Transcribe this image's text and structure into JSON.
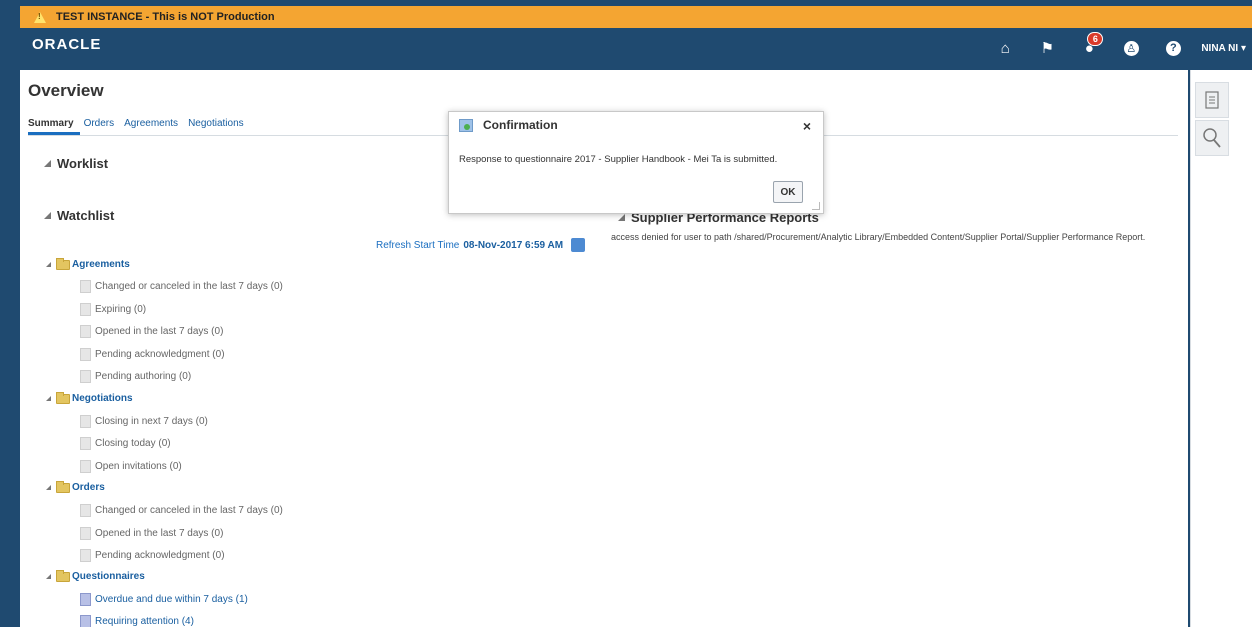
{
  "banner": {
    "text": "TEST INSTANCE - This is NOT Production"
  },
  "header": {
    "logo": "ORACLE",
    "notification_count": "6",
    "user": "NINA NI"
  },
  "page": {
    "title": "Overview",
    "tabs": [
      "Summary",
      "Orders",
      "Agreements",
      "Negotiations"
    ],
    "active_tab": "Summary"
  },
  "worklist": {
    "title": "Worklist"
  },
  "watchlist": {
    "title": "Watchlist",
    "refresh_label": "Refresh Start Time",
    "refresh_time": "08-Nov-2017 6:59 AM",
    "groups": [
      {
        "name": "Agreements",
        "items": [
          "Changed or canceled in the last 7 days (0)",
          "Expiring (0)",
          "Opened in the last 7 days (0)",
          "Pending acknowledgment (0)",
          "Pending authoring (0)"
        ]
      },
      {
        "name": "Negotiations",
        "items": [
          "Closing in next 7 days (0)",
          "Closing today (0)",
          "Open invitations (0)"
        ]
      },
      {
        "name": "Orders",
        "items": [
          "Changed or canceled in the last 7 days (0)",
          "Opened in the last 7 days (0)",
          "Pending acknowledgment (0)"
        ]
      },
      {
        "name": "Questionnaires",
        "items": [
          "Overdue and due within 7 days (1)",
          "Requiring attention (4)"
        ]
      }
    ]
  },
  "supplier_reports": {
    "title": "Supplier Performance Reports",
    "message": "access denied for user to path /shared/Procurement/Analytic Library/Embedded Content/Supplier Portal/Supplier Performance Report."
  },
  "dialog": {
    "title": "Confirmation",
    "message": "Response to questionnaire 2017 - Supplier Handbook - Mei Ta is submitted.",
    "ok_label": "OK",
    "close_symbol": "×"
  },
  "colors": {
    "header_bg": "#1f4a70",
    "banner_bg": "#f4a532",
    "link": "#1a5fa0"
  }
}
